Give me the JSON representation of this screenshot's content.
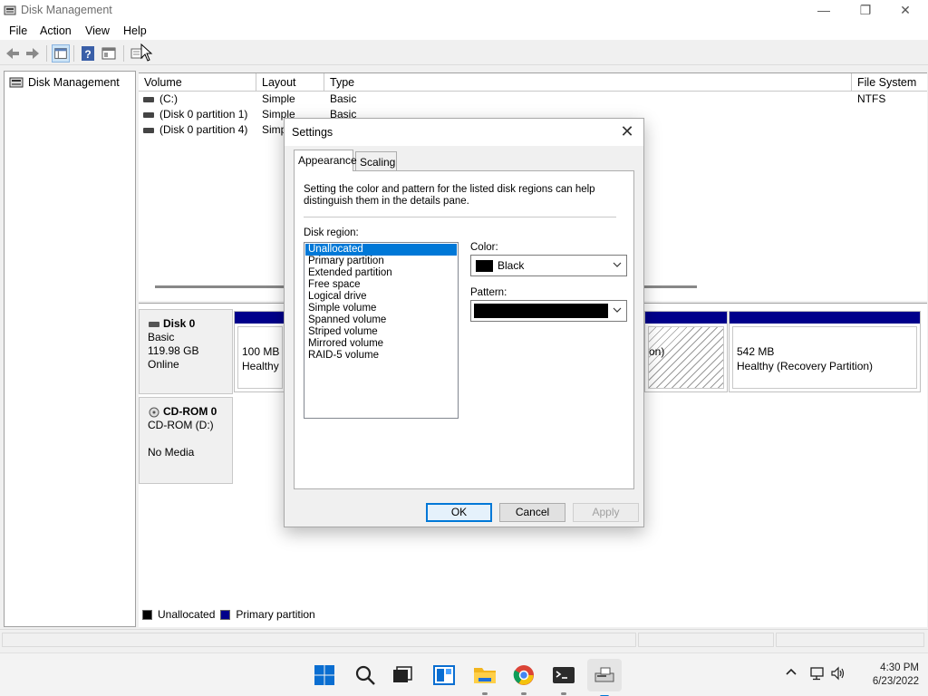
{
  "window": {
    "title": "Disk Management",
    "controls": {
      "minimize": "—",
      "maximize": "❐",
      "close": "✕"
    }
  },
  "menu": [
    "File",
    "Action",
    "View",
    "Help"
  ],
  "tree": {
    "root": "Disk Management"
  },
  "volume_list": {
    "columns": [
      "Volume",
      "Layout",
      "Type",
      "File System"
    ],
    "rows": [
      {
        "volume": "(C:)",
        "layout": "Simple",
        "type": "Basic",
        "fs": "NTFS"
      },
      {
        "volume": "(Disk 0 partition 1)",
        "layout": "Simple",
        "type": "Basic",
        "fs": ""
      },
      {
        "volume": "(Disk 0 partition 4)",
        "layout": "Simp",
        "type": "",
        "fs": ""
      }
    ]
  },
  "disks": [
    {
      "name": "Disk 0",
      "type": "Basic",
      "size": "119.98 GB",
      "status": "Online"
    },
    {
      "name": "CD-ROM 0",
      "type": "CD-ROM (D:)",
      "size": "",
      "status": "No Media"
    }
  ],
  "partitions": [
    {
      "size": "100 MB",
      "status": "Healthy ("
    },
    {
      "size": "",
      "status": "on)"
    },
    {
      "size": "542 MB",
      "status": "Healthy (Recovery Partition)"
    }
  ],
  "legend": [
    {
      "label": "Unallocated",
      "color": "#000000"
    },
    {
      "label": "Primary partition",
      "color": "#00008b"
    }
  ],
  "dialog": {
    "title": "Settings",
    "close": "✕",
    "tabs": [
      "Appearance",
      "Scaling"
    ],
    "description": "Setting the color and pattern for the listed disk regions can help distinguish them in the details pane.",
    "disk_region_label": "Disk region:",
    "disk_regions": [
      "Unallocated",
      "Primary partition",
      "Extended partition",
      "Free space",
      "Logical drive",
      "Simple volume",
      "Spanned volume",
      "Striped volume",
      "Mirrored volume",
      "RAID-5 volume"
    ],
    "selected_region": "Unallocated",
    "color_label": "Color:",
    "color_value": "Black",
    "pattern_label": "Pattern:",
    "buttons": {
      "ok": "OK",
      "cancel": "Cancel",
      "apply": "Apply"
    }
  },
  "taskbar": {
    "time": "4:30 PM",
    "date": "6/23/2022"
  },
  "colors": {
    "accent": "#0078d7",
    "primary_partition": "#00008b"
  }
}
